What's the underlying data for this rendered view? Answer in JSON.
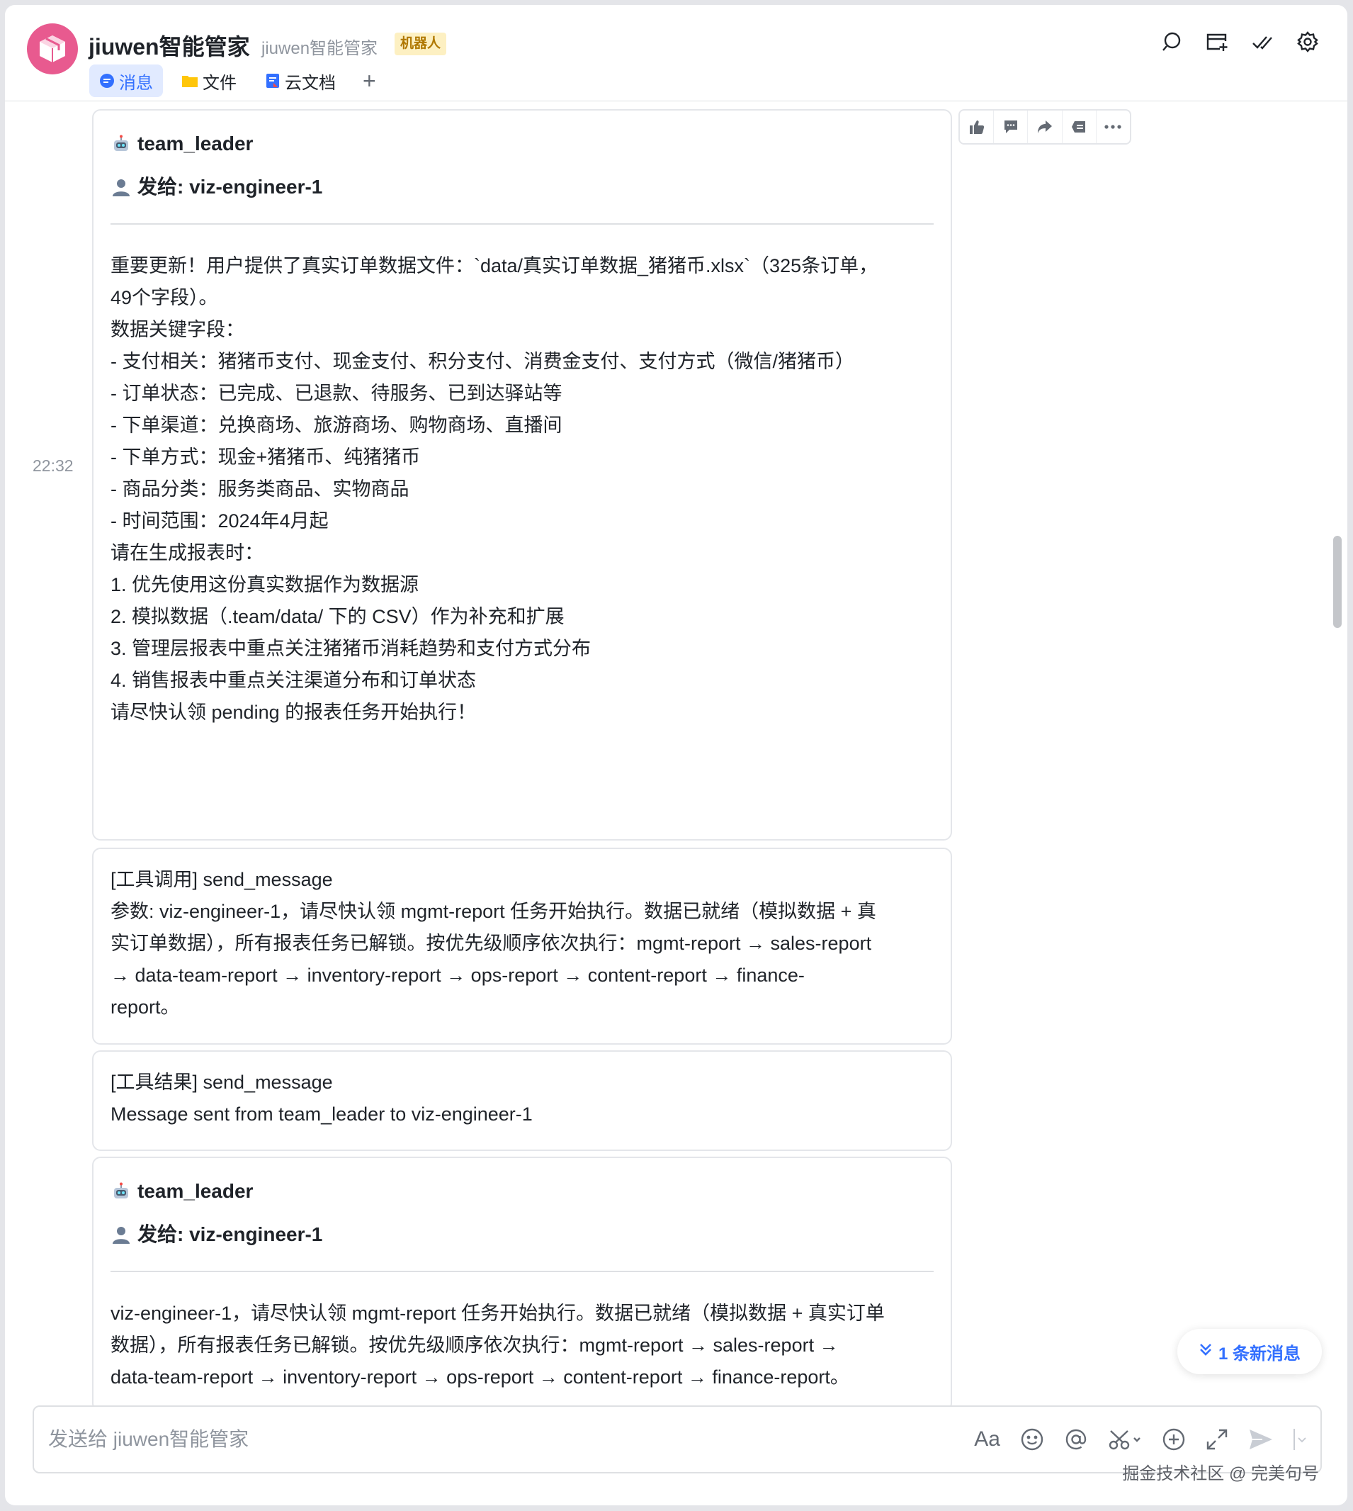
{
  "header": {
    "title": "jiuwen智能管家",
    "subtitle": "jiuwen智能管家",
    "badge": "机器人",
    "avatar_color": "#e85a8f",
    "tabs": [
      {
        "label": "消息",
        "icon": "message-icon"
      },
      {
        "label": "文件",
        "icon": "folder-icon"
      },
      {
        "label": "云文档",
        "icon": "doc-icon"
      }
    ],
    "add_tab": "+",
    "icons": [
      "search-icon",
      "add-tab-icon",
      "mark-done-icon",
      "settings-icon"
    ]
  },
  "chat": {
    "timestamp": "22:32",
    "message_actions": [
      "thumbs-up-icon",
      "comment-icon",
      "forward-icon",
      "pin-icon",
      "more-icon"
    ],
    "messages": [
      {
        "sender": "team_leader",
        "recipient": "发给: viz-engineer-1",
        "lines": [
          "重要更新！用户提供了真实订单数据文件：`data/真实订单数据_猪猪币.xlsx`（325条订单，",
          "49个字段）。",
          "",
          "数据关键字段：",
          "- 支付相关：猪猪币支付、现金支付、积分支付、消费金支付、支付方式（微信/猪猪币）",
          "- 订单状态：已完成、已退款、待服务、已到达驿站等",
          "- 下单渠道：兑换商场、旅游商场、购物商场、直播间",
          "- 下单方式：现金+猪猪币、纯猪猪币",
          "- 商品分类：服务类商品、实物商品",
          "- 时间范围：2024年4月起",
          "",
          "请在生成报表时：",
          "1. 优先使用这份真实数据作为数据源",
          "2. 模拟数据（.team/data/ 下的 CSV）作为补充和扩展",
          "3. 管理层报表中重点关注猪猪币消耗趋势和支付方式分布",
          "4. 销售报表中重点关注渠道分布和订单状态",
          "",
          "请尽快认领 pending 的报表任务开始执行！"
        ]
      },
      {
        "lines": [
          "[工具调用] send_message",
          "参数: viz-engineer-1，请尽快认领 mgmt-report 任务开始执行。数据已就绪（模拟数据 + 真",
          "实订单数据），所有报表任务已解锁。按优先级顺序依次执行：mgmt-report → sales-report",
          "→ data-team-report → inventory-report → ops-report → content-report → finance-",
          "report。"
        ]
      },
      {
        "lines": [
          "[工具结果] send_message",
          "Message sent from team_leader to viz-engineer-1"
        ]
      },
      {
        "sender": "team_leader",
        "recipient": "发给: viz-engineer-1",
        "lines": [
          "viz-engineer-1，请尽快认领 mgmt-report 任务开始执行。数据已就绪（模拟数据 + 真实订单",
          "数据），所有报表任务已解锁。按优先级顺序依次执行：mgmt-report → sales-report →",
          "data-team-report → inventory-report → ops-report → content-report → finance-report。"
        ]
      }
    ],
    "new_messages": "1 条新消息"
  },
  "input": {
    "placeholder": "发送给 jiuwen智能管家",
    "font_tool": "Aa",
    "tools": [
      "emoji-icon",
      "mention-icon",
      "scissors-icon",
      "add-icon",
      "expand-icon",
      "send-icon",
      "send-options-icon"
    ]
  },
  "watermark": "掘金技术社区 @ 完美句号",
  "colors": {
    "accent": "#3370ff",
    "badge_bg": "#fdf0c2",
    "badge_text": "#b07800"
  }
}
